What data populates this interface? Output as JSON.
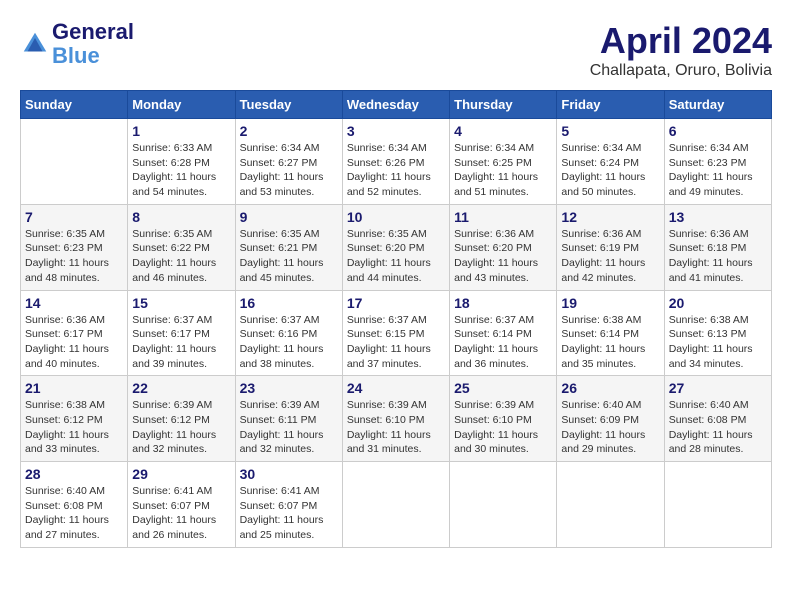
{
  "header": {
    "logo_line1": "General",
    "logo_line2": "Blue",
    "month": "April 2024",
    "location": "Challapata, Oruro, Bolivia"
  },
  "columns": [
    "Sunday",
    "Monday",
    "Tuesday",
    "Wednesday",
    "Thursday",
    "Friday",
    "Saturday"
  ],
  "weeks": [
    [
      {
        "day": "",
        "sunrise": "",
        "sunset": "",
        "daylight": ""
      },
      {
        "day": "1",
        "sunrise": "Sunrise: 6:33 AM",
        "sunset": "Sunset: 6:28 PM",
        "daylight": "Daylight: 11 hours and 54 minutes."
      },
      {
        "day": "2",
        "sunrise": "Sunrise: 6:34 AM",
        "sunset": "Sunset: 6:27 PM",
        "daylight": "Daylight: 11 hours and 53 minutes."
      },
      {
        "day": "3",
        "sunrise": "Sunrise: 6:34 AM",
        "sunset": "Sunset: 6:26 PM",
        "daylight": "Daylight: 11 hours and 52 minutes."
      },
      {
        "day": "4",
        "sunrise": "Sunrise: 6:34 AM",
        "sunset": "Sunset: 6:25 PM",
        "daylight": "Daylight: 11 hours and 51 minutes."
      },
      {
        "day": "5",
        "sunrise": "Sunrise: 6:34 AM",
        "sunset": "Sunset: 6:24 PM",
        "daylight": "Daylight: 11 hours and 50 minutes."
      },
      {
        "day": "6",
        "sunrise": "Sunrise: 6:34 AM",
        "sunset": "Sunset: 6:23 PM",
        "daylight": "Daylight: 11 hours and 49 minutes."
      }
    ],
    [
      {
        "day": "7",
        "sunrise": "Sunrise: 6:35 AM",
        "sunset": "Sunset: 6:23 PM",
        "daylight": "Daylight: 11 hours and 48 minutes."
      },
      {
        "day": "8",
        "sunrise": "Sunrise: 6:35 AM",
        "sunset": "Sunset: 6:22 PM",
        "daylight": "Daylight: 11 hours and 46 minutes."
      },
      {
        "day": "9",
        "sunrise": "Sunrise: 6:35 AM",
        "sunset": "Sunset: 6:21 PM",
        "daylight": "Daylight: 11 hours and 45 minutes."
      },
      {
        "day": "10",
        "sunrise": "Sunrise: 6:35 AM",
        "sunset": "Sunset: 6:20 PM",
        "daylight": "Daylight: 11 hours and 44 minutes."
      },
      {
        "day": "11",
        "sunrise": "Sunrise: 6:36 AM",
        "sunset": "Sunset: 6:20 PM",
        "daylight": "Daylight: 11 hours and 43 minutes."
      },
      {
        "day": "12",
        "sunrise": "Sunrise: 6:36 AM",
        "sunset": "Sunset: 6:19 PM",
        "daylight": "Daylight: 11 hours and 42 minutes."
      },
      {
        "day": "13",
        "sunrise": "Sunrise: 6:36 AM",
        "sunset": "Sunset: 6:18 PM",
        "daylight": "Daylight: 11 hours and 41 minutes."
      }
    ],
    [
      {
        "day": "14",
        "sunrise": "Sunrise: 6:36 AM",
        "sunset": "Sunset: 6:17 PM",
        "daylight": "Daylight: 11 hours and 40 minutes."
      },
      {
        "day": "15",
        "sunrise": "Sunrise: 6:37 AM",
        "sunset": "Sunset: 6:17 PM",
        "daylight": "Daylight: 11 hours and 39 minutes."
      },
      {
        "day": "16",
        "sunrise": "Sunrise: 6:37 AM",
        "sunset": "Sunset: 6:16 PM",
        "daylight": "Daylight: 11 hours and 38 minutes."
      },
      {
        "day": "17",
        "sunrise": "Sunrise: 6:37 AM",
        "sunset": "Sunset: 6:15 PM",
        "daylight": "Daylight: 11 hours and 37 minutes."
      },
      {
        "day": "18",
        "sunrise": "Sunrise: 6:37 AM",
        "sunset": "Sunset: 6:14 PM",
        "daylight": "Daylight: 11 hours and 36 minutes."
      },
      {
        "day": "19",
        "sunrise": "Sunrise: 6:38 AM",
        "sunset": "Sunset: 6:14 PM",
        "daylight": "Daylight: 11 hours and 35 minutes."
      },
      {
        "day": "20",
        "sunrise": "Sunrise: 6:38 AM",
        "sunset": "Sunset: 6:13 PM",
        "daylight": "Daylight: 11 hours and 34 minutes."
      }
    ],
    [
      {
        "day": "21",
        "sunrise": "Sunrise: 6:38 AM",
        "sunset": "Sunset: 6:12 PM",
        "daylight": "Daylight: 11 hours and 33 minutes."
      },
      {
        "day": "22",
        "sunrise": "Sunrise: 6:39 AM",
        "sunset": "Sunset: 6:12 PM",
        "daylight": "Daylight: 11 hours and 32 minutes."
      },
      {
        "day": "23",
        "sunrise": "Sunrise: 6:39 AM",
        "sunset": "Sunset: 6:11 PM",
        "daylight": "Daylight: 11 hours and 32 minutes."
      },
      {
        "day": "24",
        "sunrise": "Sunrise: 6:39 AM",
        "sunset": "Sunset: 6:10 PM",
        "daylight": "Daylight: 11 hours and 31 minutes."
      },
      {
        "day": "25",
        "sunrise": "Sunrise: 6:39 AM",
        "sunset": "Sunset: 6:10 PM",
        "daylight": "Daylight: 11 hours and 30 minutes."
      },
      {
        "day": "26",
        "sunrise": "Sunrise: 6:40 AM",
        "sunset": "Sunset: 6:09 PM",
        "daylight": "Daylight: 11 hours and 29 minutes."
      },
      {
        "day": "27",
        "sunrise": "Sunrise: 6:40 AM",
        "sunset": "Sunset: 6:08 PM",
        "daylight": "Daylight: 11 hours and 28 minutes."
      }
    ],
    [
      {
        "day": "28",
        "sunrise": "Sunrise: 6:40 AM",
        "sunset": "Sunset: 6:08 PM",
        "daylight": "Daylight: 11 hours and 27 minutes."
      },
      {
        "day": "29",
        "sunrise": "Sunrise: 6:41 AM",
        "sunset": "Sunset: 6:07 PM",
        "daylight": "Daylight: 11 hours and 26 minutes."
      },
      {
        "day": "30",
        "sunrise": "Sunrise: 6:41 AM",
        "sunset": "Sunset: 6:07 PM",
        "daylight": "Daylight: 11 hours and 25 minutes."
      },
      {
        "day": "",
        "sunrise": "",
        "sunset": "",
        "daylight": ""
      },
      {
        "day": "",
        "sunrise": "",
        "sunset": "",
        "daylight": ""
      },
      {
        "day": "",
        "sunrise": "",
        "sunset": "",
        "daylight": ""
      },
      {
        "day": "",
        "sunrise": "",
        "sunset": "",
        "daylight": ""
      }
    ]
  ]
}
